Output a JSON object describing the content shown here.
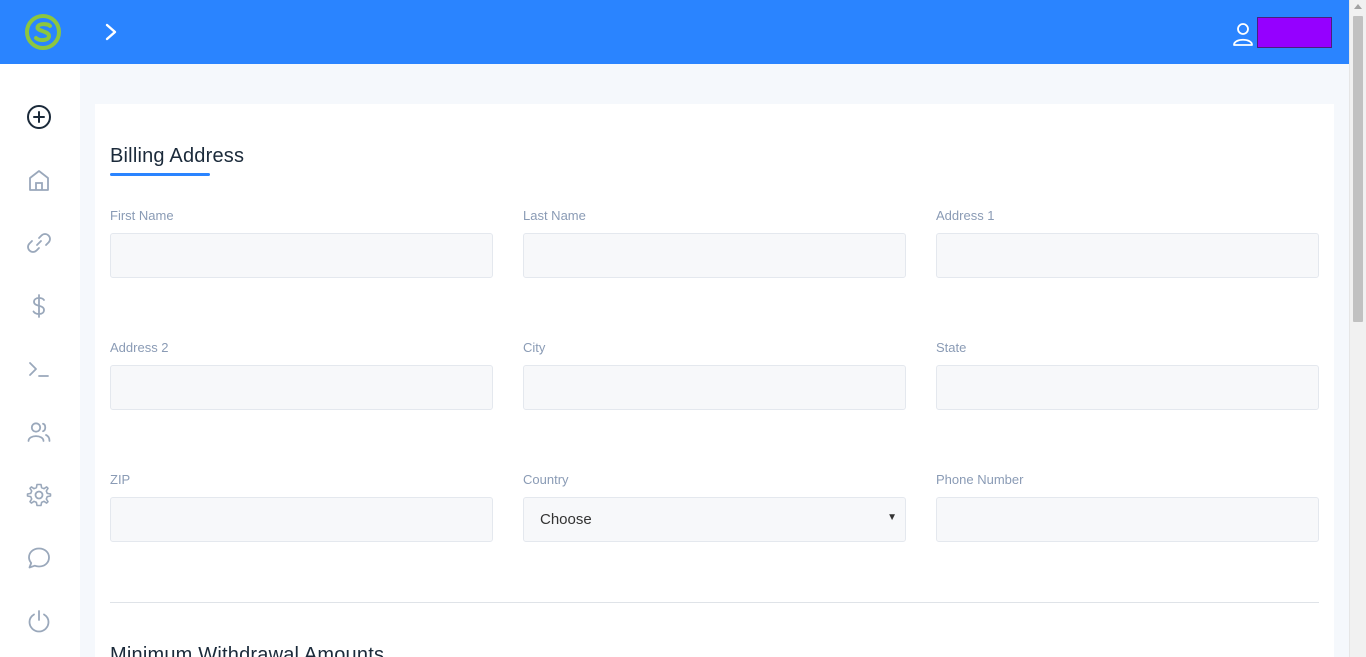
{
  "colors": {
    "topbar": "#2a84ff",
    "accent": "#2a84ff",
    "user_badge": "#9500ff"
  },
  "header": {
    "logo_icon": "s-logo-icon",
    "expand_icon": "chevron-right-icon",
    "user_icon": "user-icon"
  },
  "sidebar": {
    "items": [
      {
        "icon": "plus-circle-icon"
      },
      {
        "icon": "home-icon"
      },
      {
        "icon": "link-icon"
      },
      {
        "icon": "dollar-icon"
      },
      {
        "icon": "terminal-icon"
      },
      {
        "icon": "users-icon"
      },
      {
        "icon": "gear-icon"
      },
      {
        "icon": "chat-icon"
      },
      {
        "icon": "power-icon"
      }
    ]
  },
  "billing": {
    "title": "Billing Address",
    "fields": {
      "first_name": {
        "label": "First Name",
        "value": ""
      },
      "last_name": {
        "label": "Last Name",
        "value": ""
      },
      "address1": {
        "label": "Address 1",
        "value": ""
      },
      "address2": {
        "label": "Address 2",
        "value": ""
      },
      "city": {
        "label": "City",
        "value": ""
      },
      "state": {
        "label": "State",
        "value": ""
      },
      "zip": {
        "label": "ZIP",
        "value": ""
      },
      "country": {
        "label": "Country",
        "value": "Choose"
      },
      "phone": {
        "label": "Phone Number",
        "value": ""
      }
    }
  },
  "withdrawal": {
    "title": "Minimum Withdrawal Amounts"
  }
}
